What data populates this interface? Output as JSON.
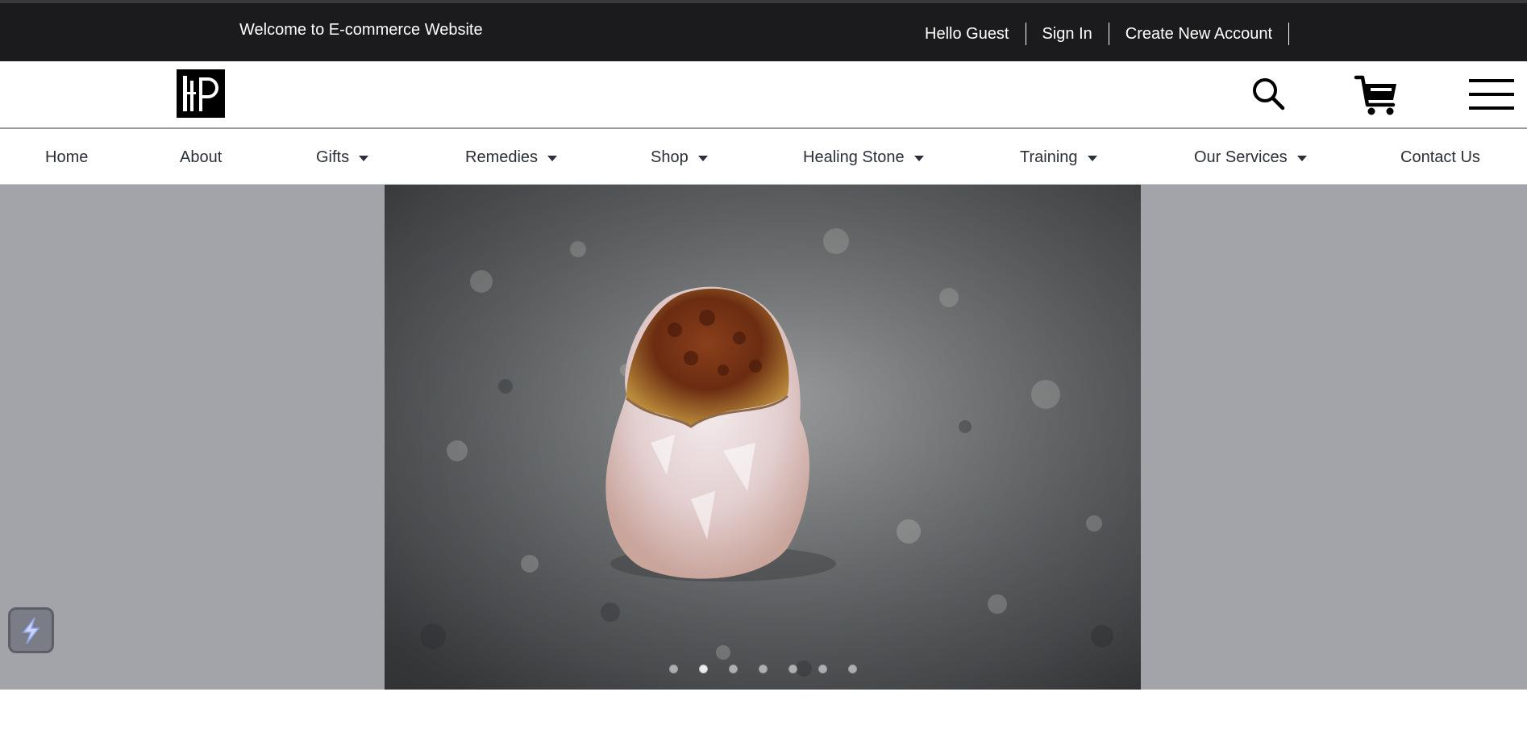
{
  "topbar": {
    "welcome": "Welcome to E-commerce Website",
    "hello": "Hello Guest",
    "signin": "Sign In",
    "create_account": "Create New Account"
  },
  "header": {
    "logo_alt": "PP",
    "icons": [
      "search-icon",
      "cart-icon",
      "hamburger-menu-icon"
    ]
  },
  "nav": {
    "items": [
      {
        "label": "Home",
        "dropdown": false
      },
      {
        "label": "About",
        "dropdown": false
      },
      {
        "label": "Gifts",
        "dropdown": true
      },
      {
        "label": "Remedies",
        "dropdown": true
      },
      {
        "label": "Shop",
        "dropdown": true
      },
      {
        "label": "Healing Stone",
        "dropdown": true
      },
      {
        "label": "Training",
        "dropdown": true
      },
      {
        "label": "Our Services",
        "dropdown": true
      },
      {
        "label": "Contact Us",
        "dropdown": false
      }
    ]
  },
  "hero": {
    "slide_count": 7,
    "active_slide": 1,
    "image": "citrine-quartz-crystal-on-granite"
  },
  "colors": {
    "topbar_bg": "#1b1b1d",
    "hero_bg": "#a3a3aa",
    "nav_text": "#2b2f38"
  }
}
